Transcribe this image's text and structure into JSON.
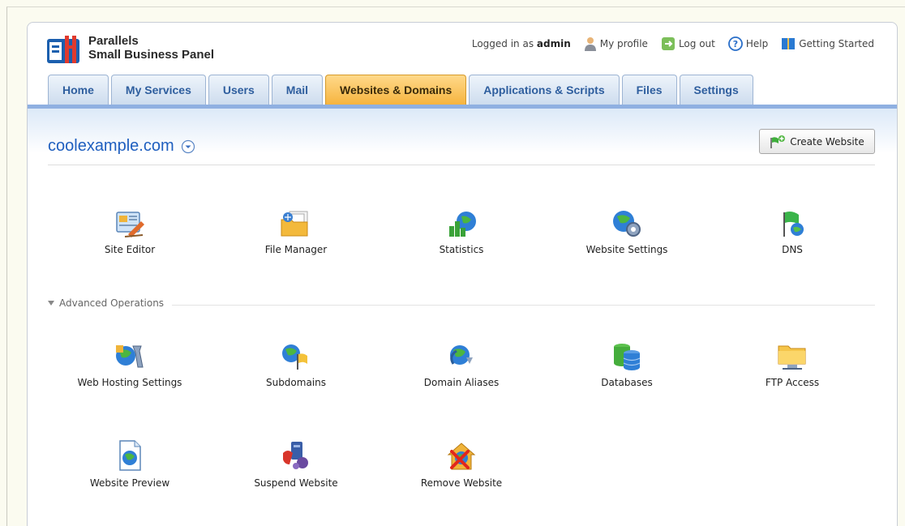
{
  "header": {
    "brand_line1": "Parallels",
    "brand_line2": "Small Business Panel",
    "logged_in_prefix": "Logged in as",
    "logged_in_user": "admin",
    "my_profile": "My profile",
    "log_out": "Log out",
    "help": "Help",
    "getting_started": "Getting Started"
  },
  "tabs": [
    {
      "label": "Home",
      "active": false
    },
    {
      "label": "My Services",
      "active": false
    },
    {
      "label": "Users",
      "active": false
    },
    {
      "label": "Mail",
      "active": false
    },
    {
      "label": "Websites & Domains",
      "active": true
    },
    {
      "label": "Applications & Scripts",
      "active": false
    },
    {
      "label": "Files",
      "active": false
    },
    {
      "label": "Settings",
      "active": false
    }
  ],
  "domain": {
    "name": "coolexample.com",
    "create_website_label": "Create Website"
  },
  "tools": [
    {
      "label": "Site Editor",
      "icon": "site-editor-icon"
    },
    {
      "label": "File Manager",
      "icon": "file-manager-icon"
    },
    {
      "label": "Statistics",
      "icon": "statistics-icon"
    },
    {
      "label": "Website Settings",
      "icon": "website-settings-icon"
    },
    {
      "label": "DNS",
      "icon": "dns-icon"
    }
  ],
  "advanced": {
    "title": "Advanced Operations",
    "tools": [
      {
        "label": "Web Hosting Settings",
        "icon": "web-hosting-settings-icon"
      },
      {
        "label": "Subdomains",
        "icon": "subdomains-icon"
      },
      {
        "label": "Domain Aliases",
        "icon": "domain-aliases-icon"
      },
      {
        "label": "Databases",
        "icon": "databases-icon"
      },
      {
        "label": "FTP Access",
        "icon": "ftp-access-icon"
      },
      {
        "label": "Website Preview",
        "icon": "website-preview-icon"
      },
      {
        "label": "Suspend Website",
        "icon": "suspend-website-icon"
      },
      {
        "label": "Remove Website",
        "icon": "remove-website-icon"
      }
    ]
  },
  "colors": {
    "active_tab": "#f6b43f",
    "tab_text": "#2e5e9e",
    "domain_link": "#1f5fbf",
    "tab_strip": "#8fb0e1"
  }
}
